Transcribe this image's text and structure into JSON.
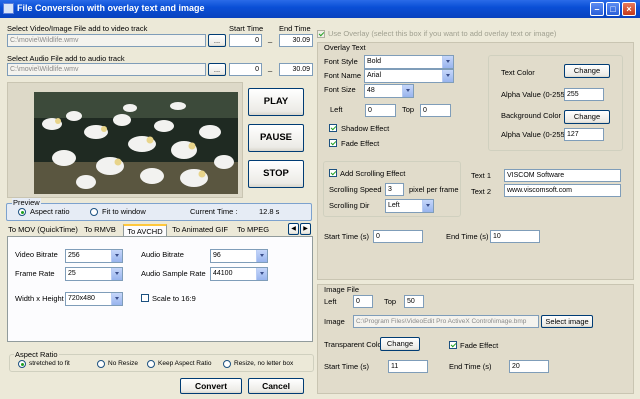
{
  "window": {
    "title": "File Conversion with overlay text and image"
  },
  "video_source": {
    "label": "Select Video/Image File add to video track",
    "path": "C:\\movie\\Wildlife.wmv",
    "start_time": "0",
    "end_time": "30.09"
  },
  "audio_source": {
    "label": "Select Audio File add to audio track",
    "path": "C:\\movie\\Wildlife.wmv",
    "start_time": "0",
    "end_time": "30.09"
  },
  "time_headers": {
    "start": "Start Time",
    "end": "End Time",
    "dash": "_",
    "browse": "..."
  },
  "playback": {
    "play": "PLAY",
    "pause": "PAUSE",
    "stop": "STOP"
  },
  "preview": {
    "title": "Preview",
    "aspect_ratio": "Aspect ratio",
    "fit_to_window": "Fit to window",
    "current_time_label": "Current Time :",
    "current_time_value": "12.8 s",
    "selected": "aspect_ratio"
  },
  "tabs": [
    {
      "label": "To MOV (QuickTime)",
      "active": false
    },
    {
      "label": "To RMVB",
      "active": false
    },
    {
      "label": "To AVCHD",
      "active": true
    },
    {
      "label": "To Animated GIF",
      "active": false
    },
    {
      "label": "To MPEG",
      "active": false
    }
  ],
  "encoding": {
    "video_bitrate_label": "Video Bitrate",
    "video_bitrate": "256",
    "frame_rate_label": "Frame Rate",
    "frame_rate": "25",
    "size_label": "Width x Height",
    "size": "720x480",
    "audio_bitrate_label": "Audio Bitrate",
    "audio_bitrate": "96",
    "sample_rate_label": "Audio Sample Rate",
    "sample_rate": "44100",
    "scale_label": "Scale to 16:9",
    "scale_checked": false
  },
  "aspect": {
    "title": "Aspect Ratio",
    "options": [
      "stretched to fit",
      "No Resize",
      "Keep Aspect Ratio",
      "Resize, no letter box"
    ],
    "selected": 0
  },
  "actions": {
    "convert": "Convert",
    "cancel": "Cancel"
  },
  "overlay": {
    "use_overlay_label": "Use Overlay (select this box if you want to add overlay text or image)",
    "use_overlay_checked": true,
    "text_section_title": "Overlay Text",
    "font_style_label": "Font Style",
    "font_style": "Bold",
    "font_name_label": "Font Name",
    "font_name": "Arial",
    "font_size_label": "Font Size",
    "font_size": "48",
    "left_label": "Left",
    "left": "0",
    "top_label": "Top",
    "top": "0",
    "shadow_label": "Shadow Effect",
    "shadow_checked": true,
    "fade_label": "Fade Effect",
    "fade_checked": true,
    "text_color_label": "Text Color",
    "change_label": "Change",
    "alpha_label": "Alpha Value (0-255)",
    "text_alpha": "255",
    "bg_color_label": "Background Color",
    "bg_alpha": "127",
    "scroll_label": "Add Scrolling Effect",
    "scroll_checked": true,
    "speed_label": "Scrolling Speed",
    "speed": "3",
    "speed_unit": "pixel per frame",
    "dir_label": "Scrolling Dir",
    "dir": "Left",
    "text1_label": "Text 1",
    "text1": "VISCOM Software",
    "text2_label": "Text 2",
    "text2": "www.viscomsoft.com",
    "start_label": "Start Time (s)",
    "start": "0",
    "end_label": "End Time (s)",
    "end": "10"
  },
  "image_file": {
    "title": "Image File",
    "left_label": "Left",
    "left": "0",
    "top_label": "Top",
    "top": "50",
    "image_label": "Image",
    "image_path": "C:\\Program Files\\VideoEdit Pro ActiveX Control\\image.bmp",
    "select_label": "Select image",
    "transparent_label": "Transparent Color",
    "change_label": "Change",
    "fade_label": "Fade Effect",
    "fade_checked": true,
    "start_label": "Start Time (s)",
    "start": "11",
    "end_label": "End Time (s)",
    "end": "20"
  },
  "colors": {
    "titlebar": "#0A4FD6",
    "preview_border": "#7DA2CE",
    "window_bg": "#ECE9D8"
  }
}
